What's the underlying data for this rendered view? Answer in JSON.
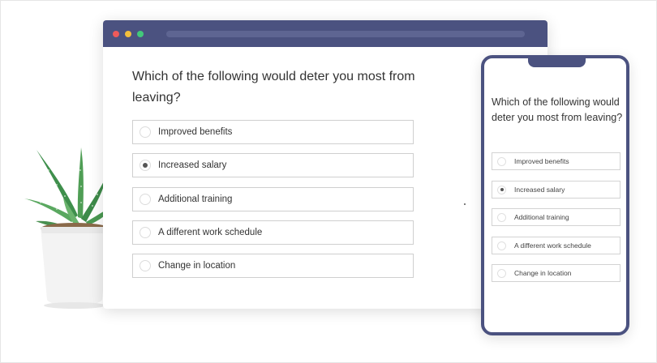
{
  "desktop": {
    "question": "Which of the following would deter you most from leaving?",
    "options": [
      {
        "label": "Improved benefits",
        "selected": false
      },
      {
        "label": "Increased salary",
        "selected": true
      },
      {
        "label": "Additional training",
        "selected": false
      },
      {
        "label": "A different work schedule",
        "selected": false
      },
      {
        "label": "Change in location",
        "selected": false
      }
    ]
  },
  "mobile": {
    "question": "Which of the following would deter you most from leaving?",
    "options": [
      {
        "label": "Improved benefits",
        "selected": false
      },
      {
        "label": "Increased salary",
        "selected": true
      },
      {
        "label": "Additional training",
        "selected": false
      },
      {
        "label": "A different work schedule",
        "selected": false
      },
      {
        "label": "Change in location",
        "selected": false
      }
    ]
  },
  "colors": {
    "frame_accent": "#4b5280",
    "window_close": "#ee5a5a",
    "window_minimize": "#f2bf3c",
    "window_maximize": "#42c97a"
  },
  "icons": [
    "plant-illustration",
    "radio-button-icon",
    "window-control-dots"
  ]
}
